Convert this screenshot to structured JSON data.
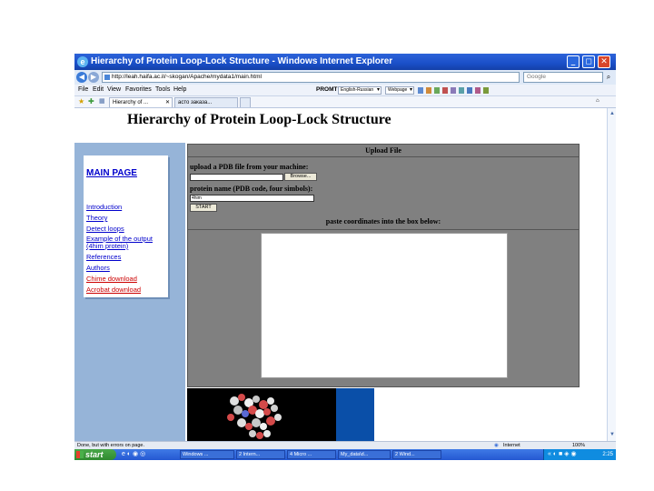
{
  "window": {
    "title": "Hierarchy of Protein Loop-Lock Structure - Windows Internet Explorer",
    "min": "_",
    "max": "◻",
    "close": "✕"
  },
  "address_bar": {
    "back": "◀",
    "forward": "▶",
    "url": "http://leah.haifa.ac.il/~skogan/Apache/mydata1/main.html",
    "search_placeholder": "Google",
    "search_icon": "magnifier-icon"
  },
  "menu": [
    "File",
    "Edit",
    "View",
    "Favorites",
    "Tools",
    "Help"
  ],
  "toolbar": {
    "label": "PROMT",
    "dropdown1": "English-Russian",
    "dropdown2": "Webpage"
  },
  "tabs": [
    {
      "label": "Hierarchy of ..."
    },
    {
      "label": "асто заказа..."
    }
  ],
  "page": {
    "heading": "Hierarchy of Protein Loop-Lock Structure",
    "nav": {
      "main_page": "MAIN PAGE",
      "links": [
        "Introduction",
        "Theory",
        "Detect loops",
        "Example of the output (4him protein)",
        "References",
        "Authors",
        "Chime download",
        "Acrobat download"
      ]
    },
    "upload": {
      "title": "Upload File",
      "pdb_label": "upload a PDB file from your machine:",
      "browse_button": "Browse...",
      "protein_name_label": "protein name (PDB code, four simbols):",
      "protein_name_value": "4him",
      "start_button": "START",
      "paste_label": "paste coordinates into the box below:",
      "coordinates_value": ""
    }
  },
  "status": {
    "left": "Done, but with errors on page.",
    "zone": "Internet",
    "zoom": "100%"
  },
  "taskbar": {
    "start": "start",
    "tasks": [
      "Windows ...",
      "2 Intern...",
      "4 Micro ...",
      "My_data\\d...",
      "2 Wind..."
    ],
    "clock": "2:25"
  }
}
